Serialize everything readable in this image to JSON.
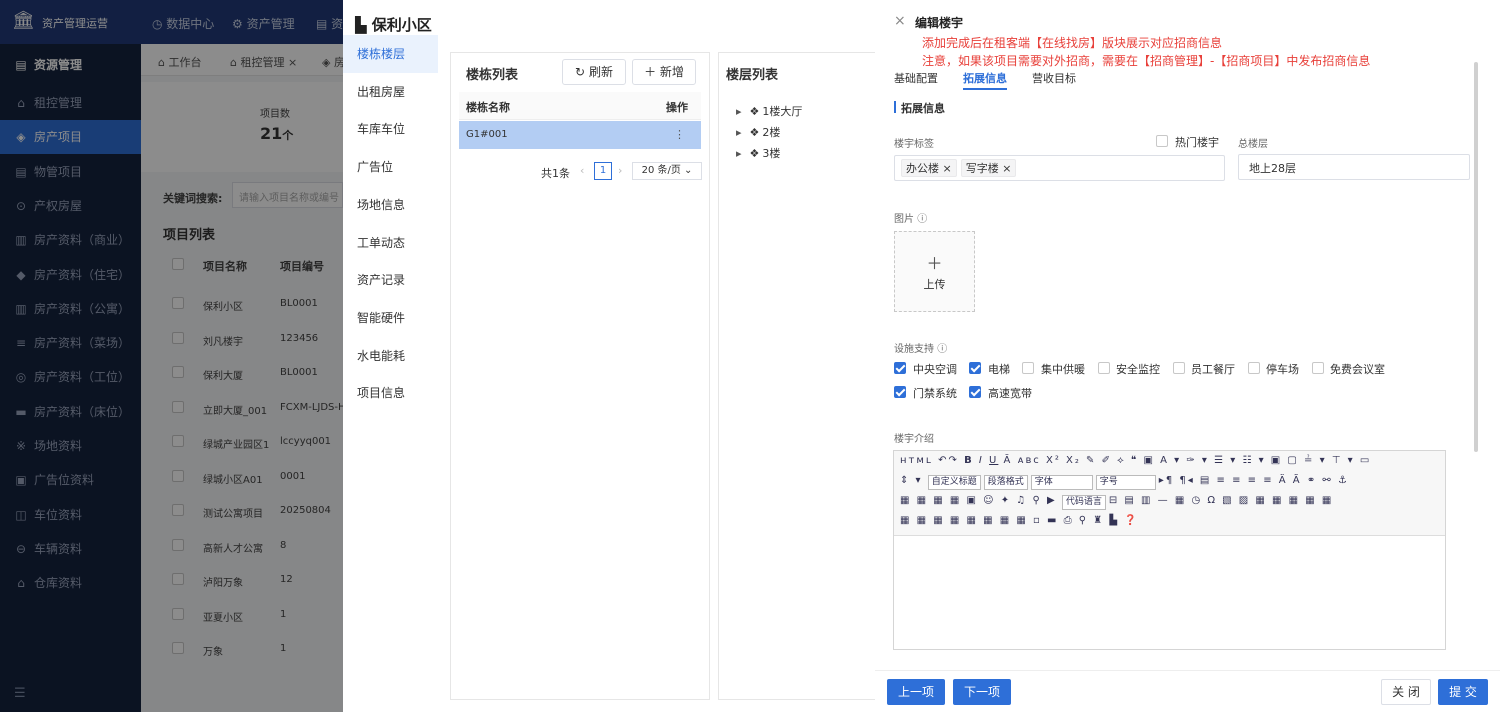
{
  "app": {
    "title": "资产管理运营"
  },
  "topnav": {
    "items": [
      "数据中心",
      "资产管理",
      "资"
    ]
  },
  "sidebar": {
    "items": [
      "资源管理",
      "租控管理",
      "房产项目",
      "物管项目",
      "产权房屋",
      "房产资料（商业）",
      "房产资料（住宅）",
      "房产资料（公寓）",
      "房产资料（菜场）",
      "房产资料（工位）",
      "房产资料（床位）",
      "场地资料",
      "广告位资料",
      "车位资料",
      "车辆资料",
      "仓库资料"
    ]
  },
  "tabs": [
    "工作台",
    "租控管理",
    "房"
  ],
  "stats": {
    "label": "项目数",
    "value": "21",
    "unit": "个"
  },
  "search": {
    "label": "关键词搜索:",
    "placeholder": "请输入项目名称或编号"
  },
  "projects": {
    "title": "项目列表",
    "headers": [
      "项目名称",
      "项目编号"
    ],
    "rows": [
      [
        "保利小区",
        "BL0001"
      ],
      [
        "刘凡楼宇",
        "123456"
      ],
      [
        "保利大厦",
        "BL0001"
      ],
      [
        "立即大厦_001",
        "FCXM-LJDS-HK"
      ],
      [
        "绿城产业园区1",
        "lccyyq001"
      ],
      [
        "绿城小区A01",
        "0001"
      ],
      [
        "测试公寓项目",
        "20250804"
      ],
      [
        "高新人才公寓",
        "8"
      ],
      [
        "泸阳万象",
        "12"
      ],
      [
        "亚夏小区",
        "1"
      ],
      [
        "万象",
        "1"
      ]
    ]
  },
  "mid": {
    "title": "保利小区",
    "menu": [
      "楼栋楼层",
      "出租房屋",
      "车库车位",
      "广告位",
      "场地信息",
      "工单动态",
      "资产记录",
      "智能硬件",
      "水电能耗",
      "项目信息"
    ],
    "building_list": {
      "title": "楼栋列表",
      "refresh": "刷新",
      "add": "新增",
      "col_name": "楼栋名称",
      "col_op": "操作",
      "row": "G1#001",
      "op_icon": "⋮",
      "total": "共1条",
      "page": "1",
      "page_size": "20 条/页"
    },
    "floor_list": {
      "title": "楼层列表",
      "floors": [
        "1楼大厅",
        "2楼",
        "3楼"
      ]
    }
  },
  "drawer": {
    "title": "编辑楼宇",
    "notice1": "添加完成后在租客端【在线找房】版块展示对应招商信息",
    "notice2": "注意，如果该项目需要对外招商，需要在【招商管理】-【招商项目】中发布招商信息",
    "tabs": [
      "基础配置",
      "拓展信息",
      "营收目标"
    ],
    "section": "拓展信息",
    "tag_label": "楼宇标签",
    "tags": [
      "办公楼",
      "写字楼"
    ],
    "hot_label": "热门楼宇",
    "floors_label": "总楼层",
    "floors_value": "地上28层",
    "image_label": "图片",
    "upload": "上传",
    "facility_label": "设施支持",
    "facilities": [
      {
        "label": "中央空调",
        "checked": true
      },
      {
        "label": "电梯",
        "checked": true
      },
      {
        "label": "集中供暖",
        "checked": false
      },
      {
        "label": "安全监控",
        "checked": false
      },
      {
        "label": "员工餐厅",
        "checked": false
      },
      {
        "label": "停车场",
        "checked": false
      },
      {
        "label": "免费会议室",
        "checked": false
      },
      {
        "label": "门禁系统",
        "checked": true
      },
      {
        "label": "高速宽带",
        "checked": true
      }
    ],
    "intro_label": "楼宇介绍",
    "editor_selects": [
      "自定义标题",
      "段落格式",
      "字体",
      "字号",
      "代码语言"
    ],
    "buttons": {
      "prev": "上一项",
      "next": "下一项",
      "close": "关 闭",
      "submit": "提 交"
    }
  },
  "colors": {
    "accent": "#2e6fd8",
    "notice": "#e8403a",
    "nav": "#213a78"
  }
}
